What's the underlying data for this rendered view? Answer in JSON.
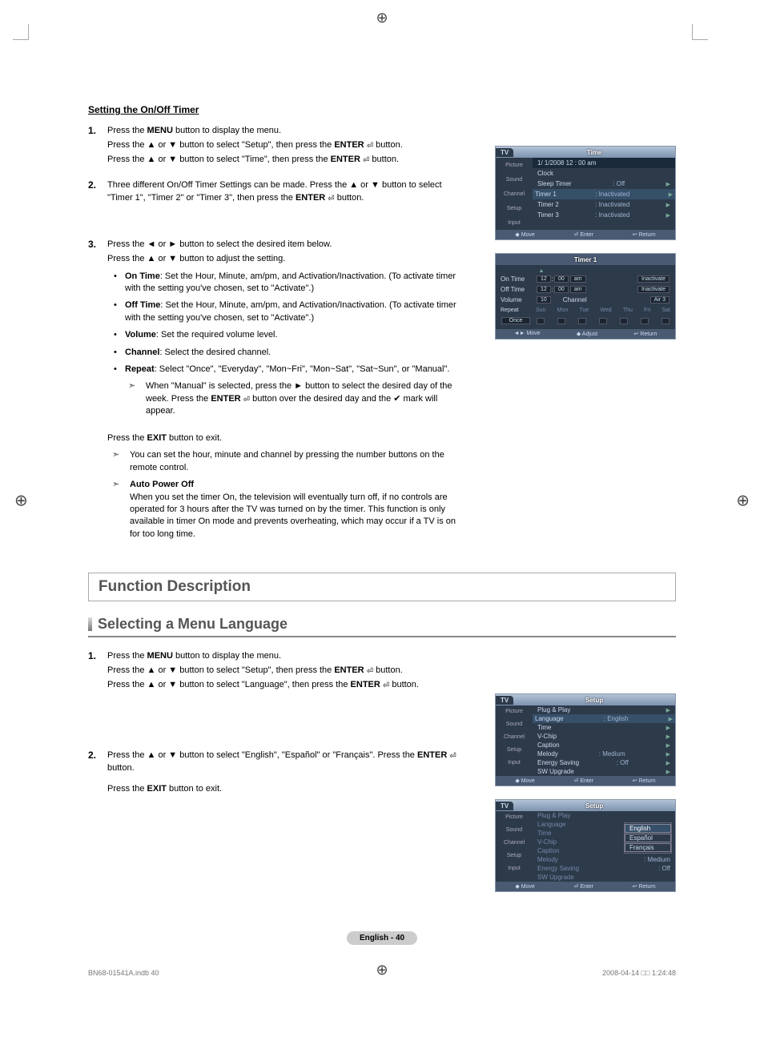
{
  "section1": {
    "title": "Setting the On/Off Timer",
    "steps": [
      {
        "n": "1.",
        "lines": [
          "Press the <b>MENU</b> button to display the menu.",
          "Press the ▲ or ▼  button to select \"Setup\", then press the <b>ENTER</b> <span class='enter-icon'>⏎</span>  button.",
          "Press the ▲ or ▼  button to select \"Time\", then press the <b>ENTER</b> <span class='enter-icon'>⏎</span>  button."
        ]
      },
      {
        "n": "2.",
        "lines": [
          "Three different On/Off Timer Settings can be made. Press the ▲ or ▼ button to select \"Timer 1\", \"Timer 2\" or \"Timer 3\", then press the  <b>ENTER</b> <span class='enter-icon'>⏎</span> button."
        ]
      },
      {
        "n": "3.",
        "lines": [
          "Press the ◄ or ► button to select the desired item below.",
          "Press the ▲ or ▼ button to adjust the setting."
        ],
        "bullets": [
          {
            "label": "On Time",
            "text": ": Set the Hour, Minute, am/pm, and Activation/Inactivation. (To activate timer with the setting you've chosen, set to \"Activate\".)"
          },
          {
            "label": "Off Time",
            "text": ": Set the Hour, Minute, am/pm, and Activation/Inactivation. (To activate timer with the setting you've chosen, set to \"Activate\".)"
          },
          {
            "label": "Volume",
            "text": ": Set the required volume level."
          },
          {
            "label": "Channel",
            "text": ": Select the desired channel."
          },
          {
            "label": "Repeat",
            "text": ": Select \"Once\", \"Everyday\", \"Mon~Fri\", \"Mon~Sat\", \"Sat~Sun\", or \"Manual\"."
          }
        ],
        "arrow1": "When \"Manual\" is selected, press the ► button to select the desired day of the week. Press the <b>ENTER</b> <span class='enter-icon'>⏎</span> button over the desired day and the ✔ mark will appear."
      }
    ],
    "exit": "Press the <b>EXIT</b> button to exit.",
    "notes": [
      "You can set the hour, minute and channel by pressing the number buttons on the remote control.",
      "<b>Auto Power Off</b><br>When you set the timer On, the television will eventually turn off, if no controls are operated for 3 hours after the TV was turned on by the timer. This function is only available in timer On mode and prevents overheating, which may occur if a TV is on for too long time."
    ]
  },
  "h1": "Function Description",
  "h2": "Selecting a Menu Language",
  "section2": {
    "steps": [
      {
        "n": "1.",
        "lines": [
          "Press the <b>MENU</b> button to display the menu.",
          "Press the ▲ or ▼ button to select \"Setup\", then press the <b>ENTER</b> <span class='enter-icon'>⏎</span>  button.",
          "Press the ▲ or ▼ button to select \"Language\", then press the <b>ENTER</b> <span class='enter-icon'>⏎</span>  button."
        ]
      },
      {
        "n": "2.",
        "lines": [
          "Press the ▲ or ▼ button to select \"English\", \"Español\" or \"Français\". Press the <b>ENTER</b> <span class='enter-icon'>⏎</span>  button.",
          "Press the <b>EXIT</b> button to exit."
        ]
      }
    ]
  },
  "osd1": {
    "tab": "TV",
    "title": "Time",
    "date": "1/  1/2008  12 : 00 am",
    "side": [
      "Picture",
      "Sound",
      "Channel",
      "Setup",
      "Input"
    ],
    "rows": [
      [
        "Clock",
        "",
        ""
      ],
      [
        "Sleep Timer",
        ": Off",
        "▶"
      ],
      [
        "Timer 1",
        ": Inactivated",
        "▶"
      ],
      [
        "Timer 2",
        ": Inactivated",
        "▶"
      ],
      [
        "Timer 3",
        ": Inactivated",
        "▶"
      ]
    ],
    "ftr": [
      "◆ Move",
      "⏎ Enter",
      "↩ Return"
    ]
  },
  "osd2": {
    "title": "Timer 1",
    "rows": [
      [
        "On Time",
        "12",
        "00",
        "am",
        "Inactivate"
      ],
      [
        "Off Time",
        "12",
        "00",
        "am",
        "Inactivate"
      ]
    ],
    "vol": [
      "Volume",
      "10",
      "Channel",
      "Air  3"
    ],
    "repeat": [
      "Repeat",
      "Sun",
      "Mon",
      "Tue",
      "Wed",
      "Thu",
      "Fri",
      "Sat"
    ],
    "once": "Once",
    "ftr": [
      "◄► Move",
      "◆ Adjust",
      "↩ Return"
    ]
  },
  "osd3": {
    "tab": "TV",
    "title": "Setup",
    "side": [
      "Picture",
      "Sound",
      "Channel",
      "Setup",
      "Input"
    ],
    "rows": [
      [
        "Plug & Play",
        "",
        "▶"
      ],
      [
        "Language",
        ": English",
        "▶"
      ],
      [
        "Time",
        "",
        "▶"
      ],
      [
        "V-Chip",
        "",
        "▶"
      ],
      [
        "Caption",
        "",
        "▶"
      ],
      [
        "Melody",
        ": Medium",
        "▶"
      ],
      [
        "Energy Saving",
        ": Off",
        "▶"
      ],
      [
        "SW Upgrade",
        "",
        "▶"
      ]
    ],
    "ftr": [
      "◆ Move",
      "⏎ Enter",
      "↩ Return"
    ],
    "highlight": 1
  },
  "osd4": {
    "tab": "TV",
    "title": "Setup",
    "side": [
      "Picture",
      "Sound",
      "Channel",
      "Setup",
      "Input"
    ],
    "rows": [
      [
        "Plug & Play",
        ""
      ],
      [
        "Language",
        ":"
      ],
      [
        "Time",
        ""
      ],
      [
        "V-Chip",
        ""
      ],
      [
        "Caption",
        ""
      ],
      [
        "Melody",
        ": Medium"
      ],
      [
        "Energy Saving",
        ": Off"
      ],
      [
        "SW Upgrade",
        ""
      ]
    ],
    "options": [
      "English",
      "Español",
      "Français"
    ],
    "ftr": [
      "◆ Move",
      "⏎ Enter",
      "↩ Return"
    ]
  },
  "pagenum": "English - 40",
  "footerLeft": "BN68-01541A.indb   40",
  "footerRight": "2008-04-14   □□ 1:24:48"
}
